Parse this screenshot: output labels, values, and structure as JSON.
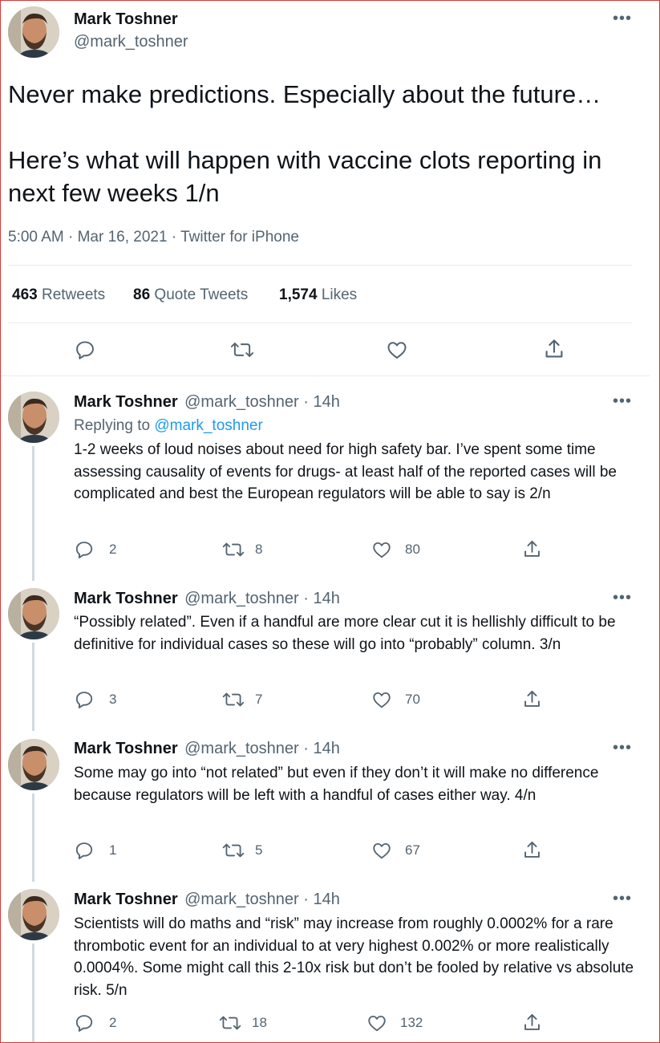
{
  "main_tweet": {
    "author_name": "Mark Toshner",
    "author_handle": "@mark_toshner",
    "text_line1": "Never make predictions. Especially about the future…",
    "text_line2": "Here’s what will happen with vaccine clots reporting in next few weeks 1/n",
    "time": "5:00 AM",
    "date": "Mar 16, 2021",
    "source": "Twitter for iPhone",
    "retweets": "463",
    "retweets_label": "Retweets",
    "quotes": "86",
    "quotes_label": "Quote Tweets",
    "likes": "1,574",
    "likes_label": "Likes"
  },
  "replies": [
    {
      "name": "Mark Toshner",
      "meta": "@mark_toshner · 14h",
      "replying_prefix": "Replying to ",
      "replying_handle": "@mark_toshner",
      "text": "1-2 weeks of loud noises about need for high safety bar. I’ve spent some time assessing causality of events for drugs- at least half of the reported cases will be complicated and best the European regulators will be able to say is 2/n",
      "reply_count": "2",
      "retweet_count": "8",
      "like_count": "80"
    },
    {
      "name": "Mark Toshner",
      "meta": "@mark_toshner · 14h",
      "text": "“Possibly related”. Even if a handful are more clear cut it is hellishly difficult to be definitive for individual cases so these will go into “probably” column. 3/n",
      "reply_count": "3",
      "retweet_count": "7",
      "like_count": "70"
    },
    {
      "name": "Mark Toshner",
      "meta": "@mark_toshner · 14h",
      "text": "Some may go into “not related” but even if they don’t it will make no difference because regulators will be left with a handful of cases either way. 4/n",
      "reply_count": "1",
      "retweet_count": "5",
      "like_count": "67"
    },
    {
      "name": "Mark Toshner",
      "meta": "@mark_toshner · 14h",
      "text": "Scientists will do maths and “risk” may increase from roughly 0.0002% for a rare thrombotic event for an individual to at very highest 0.002% or more realistically 0.0004%. Some might call this 2-10x risk but don’t be fooled by relative vs absolute risk. 5/n",
      "reply_count": "2",
      "retweet_count": "18",
      "like_count": "132"
    }
  ],
  "colors": {
    "text": "#0f1419",
    "secondary": "#536471",
    "link": "#1d9bf0",
    "divider": "#e6ecf0",
    "frame": "#d23a3a"
  },
  "icons": [
    "more-icon",
    "reply-icon",
    "retweet-icon",
    "like-icon",
    "share-icon"
  ]
}
